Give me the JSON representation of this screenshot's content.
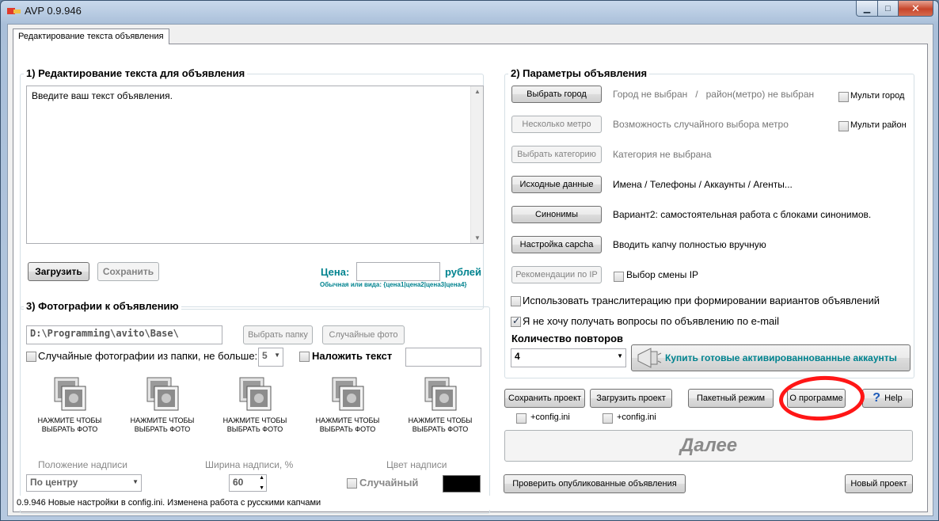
{
  "window": {
    "title": "AVP 0.9.946"
  },
  "tab": {
    "label": "Редактирование текста объявления"
  },
  "section1": {
    "title": "1) Редактирование текста для объявления",
    "text_value": "Введите ваш текст объявления.",
    "load_button": "Загрузить",
    "save_button": "Сохранить",
    "price_label": "Цена:",
    "price_value": "",
    "currency_label": "рублей",
    "price_hint": "Обычная или вида: {цена1|цена2|цена3|цена4}"
  },
  "section3": {
    "title": "3) Фотографии к объявлению",
    "folder_path": "D:\\Programming\\avito\\Base\\",
    "choose_folder_button": "Выбрать папку",
    "random_photo_button": "Случайные фото",
    "random_from_folder_label": "Случайные фотографии из папки, не больше:",
    "random_count": "5",
    "overlay_text_label": "Наложить текст",
    "overlay_text_value": "",
    "photos": [
      {
        "caption": "НАЖМИТЕ ЧТОБЫ ВЫБРАТЬ ФОТО"
      },
      {
        "caption": "НАЖМИТЕ ЧТОБЫ ВЫБРАТЬ ФОТО"
      },
      {
        "caption": "НАЖМИТЕ ЧТОБЫ ВЫБРАТЬ ФОТО"
      },
      {
        "caption": "НАЖМИТЕ ЧТОБЫ ВЫБРАТЬ ФОТО"
      },
      {
        "caption": "НАЖМИТЕ ЧТОБЫ ВЫБРАТЬ ФОТО"
      }
    ],
    "position_label": "Положение надписи",
    "position_value": "По центру",
    "width_label": "Ширина надписи, %",
    "width_value": "60",
    "color_label": "Цвет надписи",
    "random_color_label": "Случайный",
    "color_swatch": "#000000"
  },
  "section2": {
    "title": "2) Параметры объявления",
    "rows": [
      {
        "button": "Выбрать город",
        "info": "Город не выбран   /   район(метро) не выбран"
      },
      {
        "button": "Несколько метро",
        "info": "Возможность случайного выбора метро"
      },
      {
        "button": "Выбрать категорию",
        "info": "Категория не выбрана"
      },
      {
        "button": "Исходные данные",
        "info": "Имена / Телефоны / Аккаунты / Агенты..."
      },
      {
        "button": "Синонимы",
        "info": "Вариант2: самостоятельная работа с блоками синонимов."
      },
      {
        "button": "Настройка  capcha",
        "info": "Вводить капчу полностью вручную"
      },
      {
        "button": "Рекомендации по IP",
        "info": "Выбор смены IP"
      }
    ],
    "multi_city_label": "Мульти город",
    "multi_district_label": "Мульти район",
    "translit_label": "Использовать транслитерацию при формировании вариантов объявлений",
    "no_email_label": "Я не хочу получать вопросы по объявлению по e-mail",
    "repeat_label": "Количество повторов",
    "repeat_value": "4",
    "buy_accounts_button": "Купить готовые активированнованные аккаунты"
  },
  "actions": {
    "save_project": "Сохранить проект",
    "load_project": "Загрузить проект",
    "batch_mode": "Пакетный режим",
    "about": "О программе",
    "help": "Help",
    "config_label_1": "+config.ini",
    "config_label_2": "+config.ini",
    "next_button": "Далее",
    "check_published": "Проверить  опубликованные объявления",
    "new_project": "Новый проект"
  },
  "status": {
    "text": "0.9.946 Новые настройки в config.ini. Изменена работа с русскими капчами"
  },
  "colors": {
    "accent_teal": "#00838f",
    "annotation_red": "#ff1616"
  }
}
